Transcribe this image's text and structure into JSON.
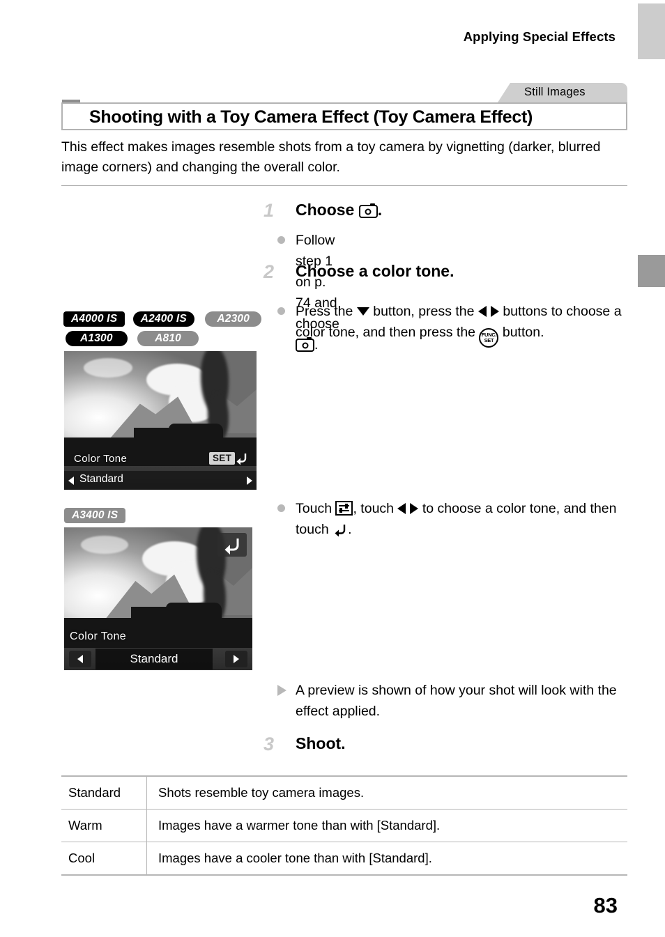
{
  "header": {
    "running_title": "Applying Special Effects",
    "page_number": "83"
  },
  "section": {
    "category_tab": "Still Images",
    "title": "Shooting with a Toy Camera Effect (Toy Camera Effect)",
    "intro": "This effect makes images resemble shots from a toy camera by vignetting (darker, blurred image corners) and changing the overall color."
  },
  "steps": [
    {
      "number": "1",
      "title_prefix": "Choose",
      "title_suffix": ".",
      "title_icon": "toy-camera-icon",
      "bullets": [
        {
          "marker": "dot",
          "text_1": "Follow step 1 on p. 74 and choose",
          "icon_1": "toy-camera-icon",
          "text_2": "."
        }
      ]
    },
    {
      "number": "2",
      "title_prefix": "Choose a color tone.",
      "title_suffix": "",
      "title_icon": "",
      "bullets": [
        {
          "marker": "dot",
          "text_1": "Press the",
          "icon_1": "arrow-down-icon",
          "text_2": "button, press the",
          "icon_2": "arrow-left-right-icon",
          "text_3": "buttons to choose a color tone, and then press the",
          "icon_3": "func-set-icon",
          "text_4": "button."
        },
        {
          "marker": "dot",
          "text_1": "Touch",
          "icon_1": "touch-menu-icon",
          "text_2": ", touch",
          "icon_2": "arrow-left-right-icon",
          "text_3": "to choose a color tone, and then touch",
          "icon_3": "return-arrow-icon",
          "text_4": "."
        },
        {
          "marker": "triangle",
          "text_1": "A preview is shown of how your shot will look with the effect applied."
        }
      ]
    },
    {
      "number": "3",
      "title_prefix": "Shoot.",
      "title_suffix": "",
      "title_icon": "",
      "bullets": []
    }
  ],
  "model_badges": {
    "group_1_row_1": [
      {
        "label": "A4000 IS",
        "style": "sq"
      },
      {
        "label": "A2400 IS",
        "style": "pill"
      },
      {
        "label": "A2300",
        "style": "gray"
      }
    ],
    "group_1_row_2": [
      {
        "label": "A1300",
        "style": "pill"
      },
      {
        "label": "A810",
        "style": "gray"
      }
    ],
    "group_2": [
      {
        "label": "A3400 IS",
        "style": "graysq"
      }
    ]
  },
  "lcd_button_screen": {
    "color_tone_label": "Color Tone",
    "set_label": "SET",
    "set_return_icon": "return-arrow-icon",
    "selected_value": "Standard",
    "left_arrow_icon": "arrow-left-icon",
    "right_arrow_icon": "arrow-right-icon"
  },
  "lcd_touch_screen": {
    "color_tone_label": "Color Tone",
    "return_icon": "return-arrow-icon",
    "selected_value": "Standard",
    "left_arrow_icon": "arrow-left-icon",
    "right_arrow_icon": "arrow-right-icon"
  },
  "table": {
    "rows": [
      {
        "key": "Standard",
        "value": "Shots resemble toy camera images."
      },
      {
        "key": "Warm",
        "value": "Images have a warmer tone than with [Standard]."
      },
      {
        "key": "Cool",
        "value": "Images have a cooler tone than with [Standard]."
      }
    ]
  },
  "colors": {
    "tab_gray": "#cfcfcf",
    "edge_tab_light": "#cccccc",
    "edge_tab_dark": "#9a9a9a",
    "badge_black": "#000000",
    "badge_gray": "#8c8c8c",
    "rule_gray": "#b6b6b6"
  }
}
